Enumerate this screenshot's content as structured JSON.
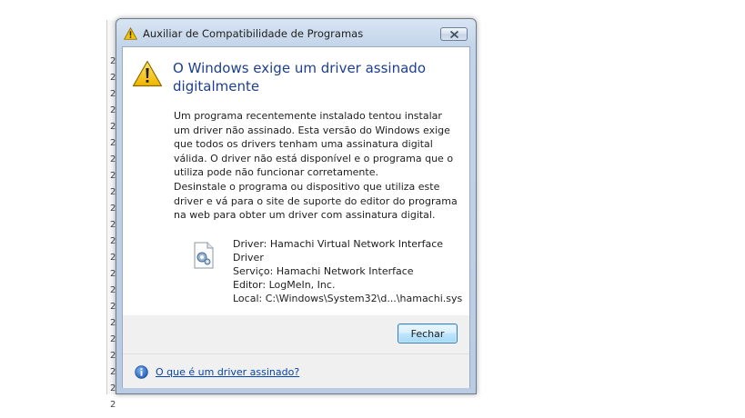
{
  "window": {
    "title": "Auxiliar de Compatibilidade de Programas",
    "close_icon": "close-icon"
  },
  "background": {
    "row_glyphs": [
      "2",
      "2",
      "2",
      "2",
      "2",
      "2",
      "2",
      "2",
      "2",
      "2",
      "2",
      "2",
      "2",
      "2",
      "2",
      "2",
      "2",
      "2",
      "2",
      "2",
      "2",
      "2"
    ]
  },
  "message": {
    "heading": "O Windows exige um driver assinado digitalmente",
    "paragraph1": "Um programa recentemente instalado tentou instalar um driver não assinado. Esta versão do Windows exige que todos os drivers tenham uma assinatura digital válida. O driver não está disponível e o programa que o utiliza pode não funcionar corretamente.",
    "paragraph2": "Desinstale o programa ou dispositivo que utiliza este driver e vá para o site de suporte do editor do programa na web para obter um driver com assinatura digital."
  },
  "details": {
    "driver": "Driver: Hamachi Virtual Network Interface Driver",
    "service": "Serviço: Hamachi Network Interface",
    "publisher": "Editor: LogMeIn, Inc.",
    "location": "Local: C:\\Windows\\System32\\d...\\hamachi.sys"
  },
  "buttons": {
    "close_label": "Fechar"
  },
  "footer": {
    "help_link": "O que é um driver assinado?"
  },
  "colors": {
    "heading": "#1e3f8f",
    "link": "#0645ad",
    "warning": "#f2c200"
  }
}
